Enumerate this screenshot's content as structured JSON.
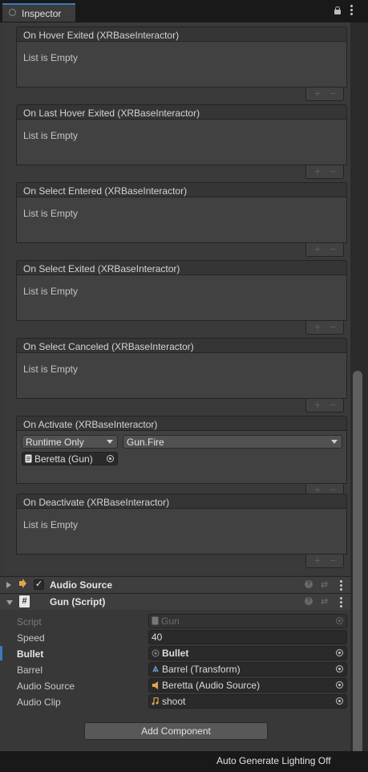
{
  "tab": {
    "label": "Inspector"
  },
  "events": [
    {
      "title": "On Hover Exited (XRBaseInteractor)",
      "empty_text": "List is Empty"
    },
    {
      "title": "On Last Hover Exited (XRBaseInteractor)",
      "empty_text": "List is Empty"
    },
    {
      "title": "On Select Entered (XRBaseInteractor)",
      "empty_text": "List is Empty"
    },
    {
      "title": "On Select Exited (XRBaseInteractor)",
      "empty_text": "List is Empty"
    },
    {
      "title": "On Select Canceled (XRBaseInteractor)",
      "empty_text": "List is Empty"
    },
    {
      "title": "On Deactivate (XRBaseInteractor)",
      "empty_text": "List is Empty"
    }
  ],
  "activate_event": {
    "title": "On Activate (XRBaseInteractor)",
    "runtime": "Runtime Only",
    "function": "Gun.Fire",
    "target": "Beretta (Gun)"
  },
  "list_controls": {
    "plus": "+",
    "minus": "−"
  },
  "audio_source_component": {
    "title": "Audio Source",
    "enabled": true
  },
  "gun_component": {
    "title": "Gun (Script)",
    "properties": [
      {
        "label": "Script",
        "value": "Gun"
      },
      {
        "label": "Speed",
        "value": "40"
      },
      {
        "label": "Bullet",
        "value": "Bullet"
      },
      {
        "label": "Barrel",
        "value": "Barrel (Transform)"
      },
      {
        "label": "Audio Source",
        "value": "Beretta (Audio Source)"
      },
      {
        "label": "Audio Clip",
        "value": "shoot"
      }
    ]
  },
  "add_component_label": "Add Component",
  "status_bar": {
    "text": "Auto Generate Lighting Off"
  },
  "colors": {
    "accent": "#3a79bb",
    "background": "#383838",
    "tab_bar": "#191919"
  }
}
